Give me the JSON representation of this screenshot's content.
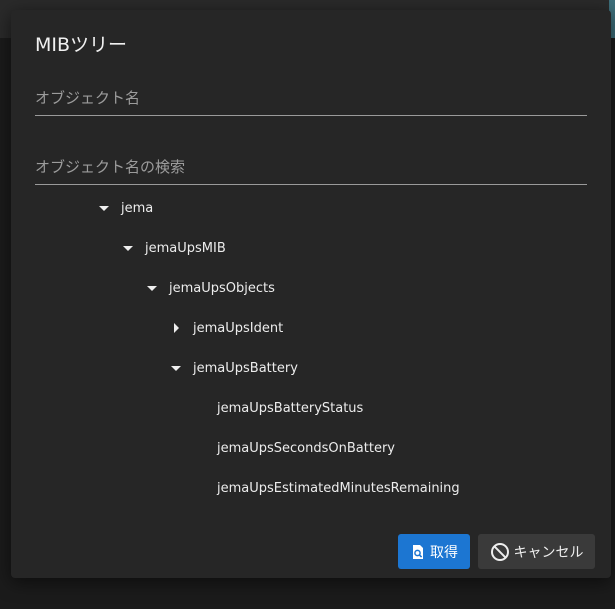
{
  "dialog": {
    "title": "MIBツリー",
    "object_name_placeholder": "オブジェクト名",
    "search_placeholder": "オブジェクト名の検索"
  },
  "tree": {
    "nodes": [
      {
        "label": "jema",
        "state": "expanded"
      },
      {
        "label": "jemaUpsMIB",
        "state": "expanded"
      },
      {
        "label": "jemaUpsObjects",
        "state": "expanded"
      },
      {
        "label": "jemaUpsIdent",
        "state": "collapsed"
      },
      {
        "label": "jemaUpsBattery",
        "state": "expanded"
      },
      {
        "label": "jemaUpsBatteryStatus",
        "state": "leaf"
      },
      {
        "label": "jemaUpsSecondsOnBattery",
        "state": "leaf"
      },
      {
        "label": "jemaUpsEstimatedMinutesRemaining",
        "state": "leaf"
      }
    ]
  },
  "buttons": {
    "get_label": "取得",
    "cancel_label": "キャンセル"
  },
  "colors": {
    "primary": "#1c76d2",
    "dialog_bg": "#262626",
    "page_bg": "#1b1b1b"
  }
}
